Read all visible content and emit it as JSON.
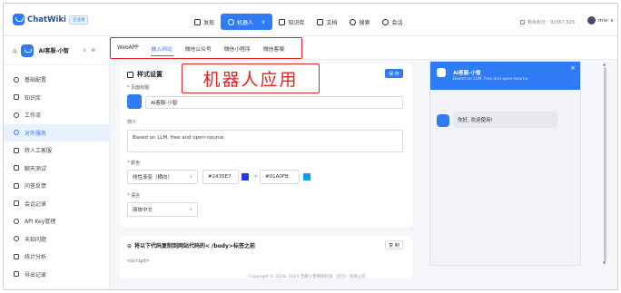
{
  "header": {
    "logo_text": "ChatWiki",
    "edition_badge": "企业版",
    "nav": [
      {
        "label": "发现",
        "icon": "home-icon"
      },
      {
        "label": "机器人",
        "icon": "robot-icon",
        "active": true
      },
      {
        "label": "知识库",
        "icon": "book-icon"
      },
      {
        "label": "文档",
        "icon": "document-icon"
      },
      {
        "label": "搜索",
        "icon": "search-icon"
      },
      {
        "label": "会话",
        "icon": "chat-icon"
      }
    ],
    "score_text": "剩余积分：92367,826",
    "user_name": "mix"
  },
  "sidebar": {
    "robot_name": "AI客服-小智",
    "items": [
      {
        "label": "基础配置",
        "icon": "gear-icon"
      },
      {
        "label": "知识库",
        "icon": "book-icon"
      },
      {
        "label": "工作流",
        "icon": "workflow-icon"
      },
      {
        "label": "对外服务",
        "icon": "share-icon",
        "active": true
      },
      {
        "label": "转人工客服",
        "icon": "agent-icon"
      },
      {
        "label": "聊天测试",
        "icon": "test-icon"
      },
      {
        "label": "问答反馈",
        "icon": "feedback-icon"
      },
      {
        "label": "会话记录",
        "icon": "record-icon"
      },
      {
        "label": "API Key管理",
        "icon": "key-icon"
      },
      {
        "label": "未知问题",
        "icon": "question-icon"
      },
      {
        "label": "统计分析",
        "icon": "stats-icon"
      },
      {
        "label": "导出记录",
        "icon": "export-icon"
      }
    ]
  },
  "tabs": [
    {
      "label": "WebAPP"
    },
    {
      "label": "嵌入网站",
      "active": true
    },
    {
      "label": "微信公众号"
    },
    {
      "label": "微信小程序"
    },
    {
      "label": "微信客服"
    }
  ],
  "annotation": "机器人应用",
  "style_card": {
    "title": "样式设置",
    "save_label": "保 存",
    "page_title_label": "页面标题",
    "page_title_value": "AI客服-小智",
    "intro_label": "简介",
    "intro_value": "Based on LLM, free and open-source.",
    "color_label": "颜色",
    "color_mode": "线性渐变（横向）",
    "color_start": "#2435E7",
    "color_end": "#01A0FB",
    "language_label": "语言",
    "language_value": "简体中文",
    "colors": {
      "start": "#2435E7",
      "end": "#01A0FB"
    }
  },
  "code_card": {
    "title": "将以下代码复制到网站代码的< /body>标签之前",
    "copy_label": "复 制",
    "code": "<script>"
  },
  "preview": {
    "name": "AI客服-小智",
    "subtitle": "Based on LLM, free and open-source.",
    "greeting": "你好, 欢迎使用!"
  },
  "footer": "Copyright © 2016- 2024 芝麻小客网络科技（武汉）有限公司"
}
